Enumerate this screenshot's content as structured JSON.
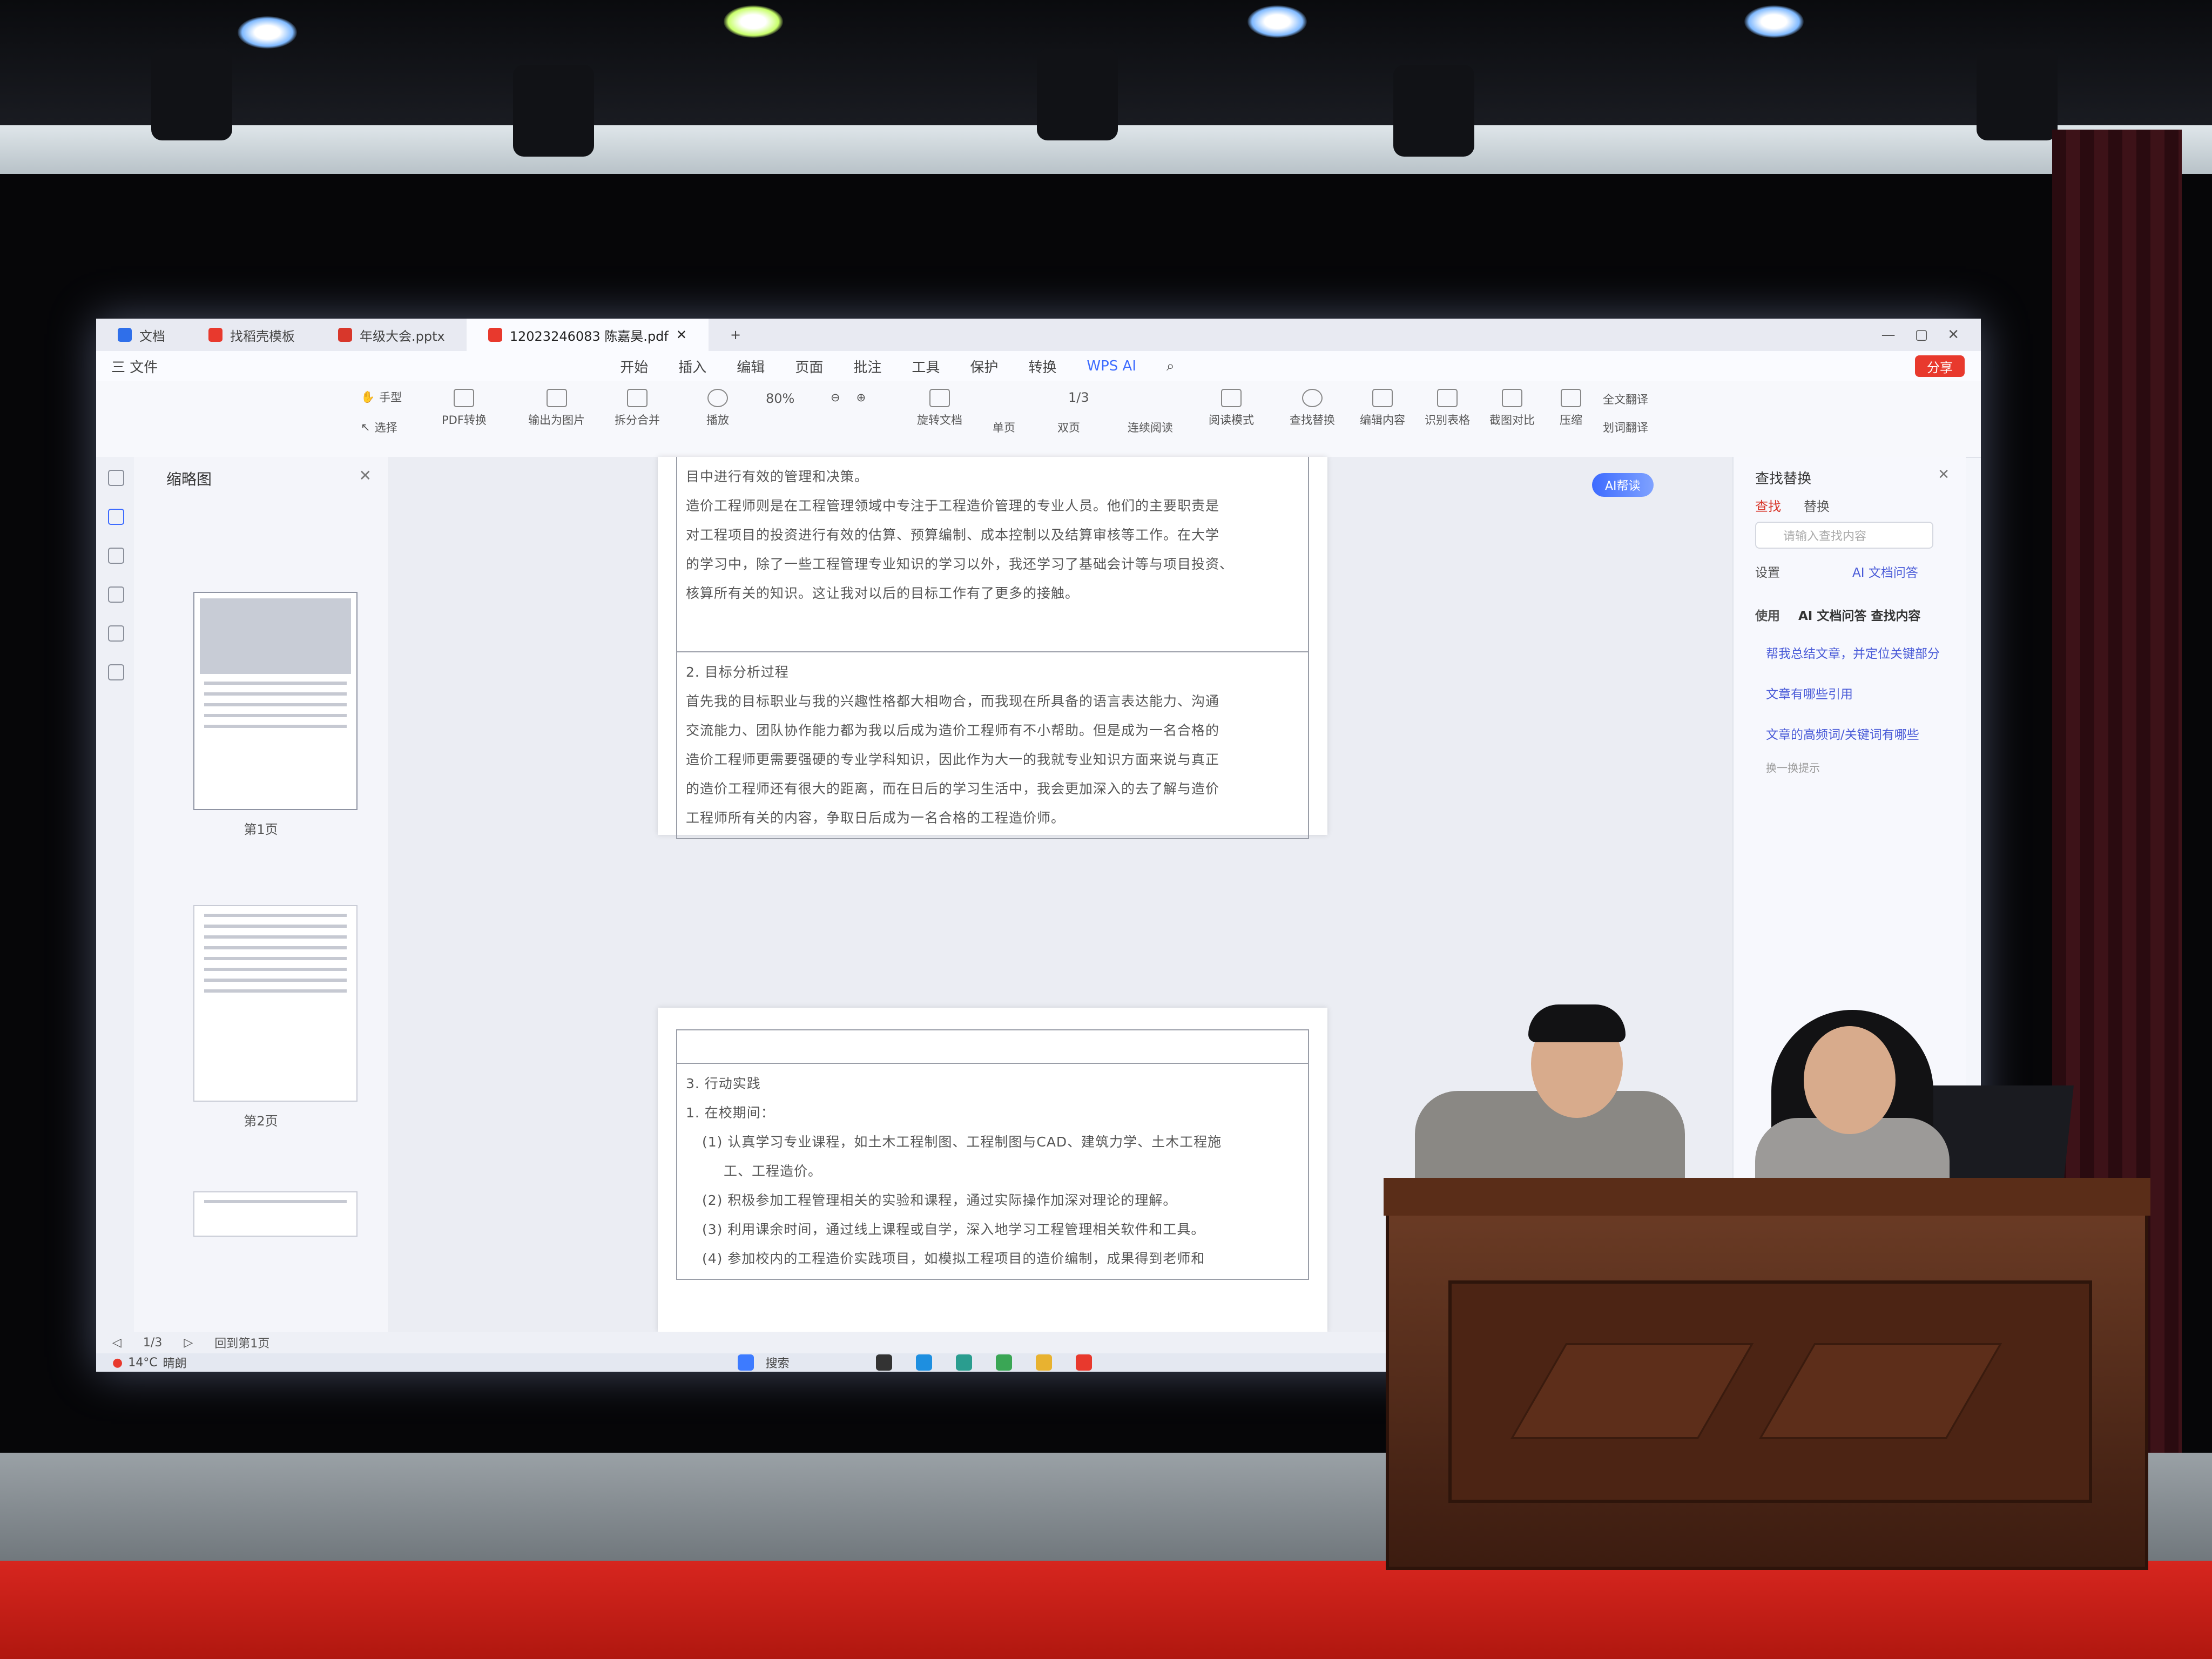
{
  "screen": {
    "tabs": [
      {
        "label": "文档",
        "color": "#2f6fea"
      },
      {
        "label": "找稻壳模板",
        "color": "#e8392d"
      },
      {
        "label": "年级大会.pptx",
        "color": "#d8372b"
      },
      {
        "label": "12023246083 陈嘉昊.pdf",
        "color": "#e8392d"
      }
    ],
    "menu": {
      "file": "三 文件",
      "items": [
        "开始",
        "插入",
        "编辑",
        "页面",
        "批注",
        "工具",
        "保护",
        "转换"
      ],
      "active": "开始",
      "wps_ai": "WPS AI",
      "share": "分享"
    },
    "ribbon": {
      "hand": "手型",
      "select": "选择",
      "pdf_convert": "PDF转换",
      "export_image": "输出为图片",
      "split_merge": "拆分合并",
      "play": "播放",
      "zoom": "80%",
      "rotate": "旋转文档",
      "single": "单页",
      "double": "双页",
      "continuous": "连续阅读",
      "read_mode": "阅读模式",
      "page_indicator": "1/3",
      "find_replace": "查找替换",
      "edit_content": "编辑内容",
      "ocr": "识别表格",
      "compare": "截图对比",
      "compress": "压缩",
      "translate_full": "全文翻译",
      "translate_mark": "划词翻译"
    },
    "thumbnails": {
      "title": "缩略图",
      "page1": "第1页",
      "page2": "第2页"
    },
    "document": {
      "section1_lines": [
        "目中进行有效的管理和决策。",
        "造价工程师则是在工程管理领域中专注于工程造价管理的专业人员。他们的主要职责是",
        "对工程项目的投资进行有效的估算、预算编制、成本控制以及结算审核等工作。在大学",
        "的学习中，除了一些工程管理专业知识的学习以外，我还学习了基础会计等与项目投资、",
        "核算所有关的知识。这让我对以后的目标工作有了更多的接触。"
      ],
      "section2_heading": "2. 目标分析过程",
      "section2_lines": [
        "首先我的目标职业与我的兴趣性格都大相吻合，而我现在所具备的语言表达能力、沟通",
        "交流能力、团队协作能力都为我以后成为造价工程师有不小帮助。但是成为一名合格的",
        "造价工程师更需要强硬的专业学科知识，因此作为大一的我就专业知识方面来说与真正",
        "的造价工程师还有很大的距离，而在日后的学习生活中，我会更加深入的去了解与造价",
        "工程师所有关的内容，争取日后成为一名合格的工程造价师。"
      ],
      "section3_heading": "3. 行动实践",
      "section3_sub": "1. 在校期间：",
      "section3_items": [
        "(1) 认真学习专业课程，如土木工程制图、工程制图与CAD、建筑力学、土木工程施",
        "工、工程造价。",
        "(2) 积极参加工程管理相关的实验和课程，通过实际操作加深对理论的理解。",
        "(3) 利用课余时间，通过线上课程或自学，深入地学习工程管理相关软件和工具。",
        "(4) 参加校内的工程造价实践项目，如模拟工程项目的造价编制，成果得到老师和"
      ],
      "ai_badge": "AI帮读"
    },
    "find_panel": {
      "title": "查找替换",
      "tab_find": "查找",
      "tab_replace": "替换",
      "placeholder": "请输入查找内容",
      "settings": "设置",
      "ai_link": "AI 文档问答",
      "use_label": "使用",
      "ai_qa": "AI 文档问答 查找内容",
      "suggestions": [
        "帮我总结文章，并定位关键部分",
        "文章有哪些引用",
        "文章的高频词/关键词有哪些"
      ],
      "more": "换一换提示"
    },
    "statusbar": {
      "page": "1/3",
      "back": "回到第1页"
    },
    "taskbar": {
      "temp": "14°C",
      "weather": "晴朗",
      "search": "搜索"
    }
  }
}
